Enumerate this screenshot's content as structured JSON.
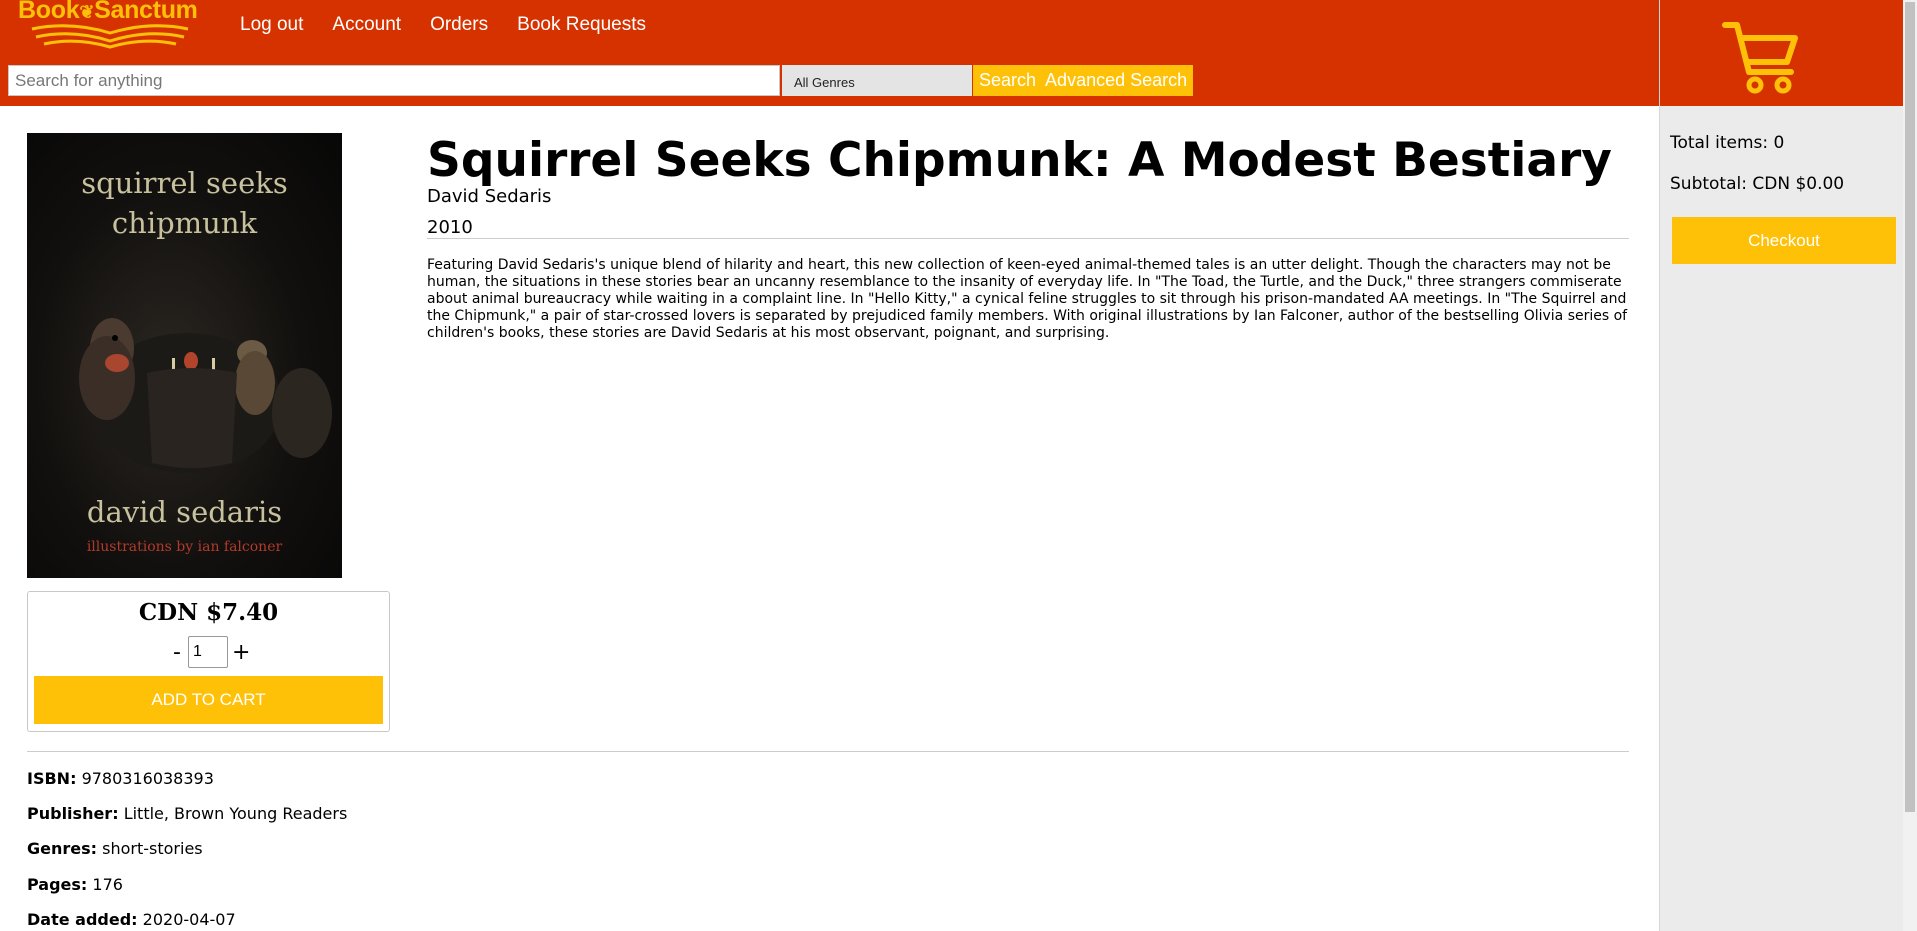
{
  "header": {
    "logo_text_1": "Book",
    "logo_leaf": "❦",
    "logo_text_2": "Sanctum",
    "nav": [
      "Log out",
      "Account",
      "Orders",
      "Book Requests"
    ],
    "search_placeholder": "Search for anything",
    "genre_selected": "All Genres",
    "search_label": "Search",
    "advanced_search_label": "Advanced Search"
  },
  "cart": {
    "icon": "cart-icon",
    "total_items_label": "Total items:",
    "total_items": "0",
    "subtotal_label": "Subtotal:",
    "subtotal": "CDN $0.00",
    "checkout_label": "Checkout"
  },
  "book": {
    "title": "Squirrel Seeks Chipmunk: A Modest Bestiary",
    "author": "David Sedaris",
    "year": "2010",
    "description": "Featuring David Sedaris's unique blend of hilarity and heart, this new collection of keen-eyed animal-themed tales is an utter delight. Though the characters may not be human, the situations in these stories bear an uncanny resemblance to the insanity of everyday life. In \"The Toad, the Turtle, and the Duck,\" three strangers commiserate about animal bureaucracy while waiting in a complaint line. In \"Hello Kitty,\" a cynical feline struggles to sit through his prison-mandated AA meetings. In \"The Squirrel and the Chipmunk,\" a pair of star-crossed lovers is separated by prejudiced family members. With original illustrations by Ian Falconer, author of the bestselling Olivia series of children's books, these stories are David Sedaris at his most observant, poignant, and surprising.",
    "cover": {
      "title_line1": "squirrel seeks",
      "title_line2": "chipmunk",
      "author": "david sedaris",
      "illustrator": "illustrations by ian falconer"
    },
    "price": "CDN $7.40",
    "minus": "-",
    "plus": "+",
    "quantity": "1",
    "add_to_cart_label": "ADD TO CART",
    "meta": {
      "isbn_label": "ISBN:",
      "isbn": "9780316038393",
      "publisher_label": "Publisher:",
      "publisher": "Little, Brown Young Readers",
      "genres_label": "Genres:",
      "genres": "short-stories",
      "pages_label": "Pages:",
      "pages": "176",
      "date_added_label": "Date added:",
      "date_added": "2020-04-07"
    }
  },
  "colors": {
    "header": "#d63200",
    "accent": "#ffc107",
    "sidebar": "#ebebeb"
  }
}
